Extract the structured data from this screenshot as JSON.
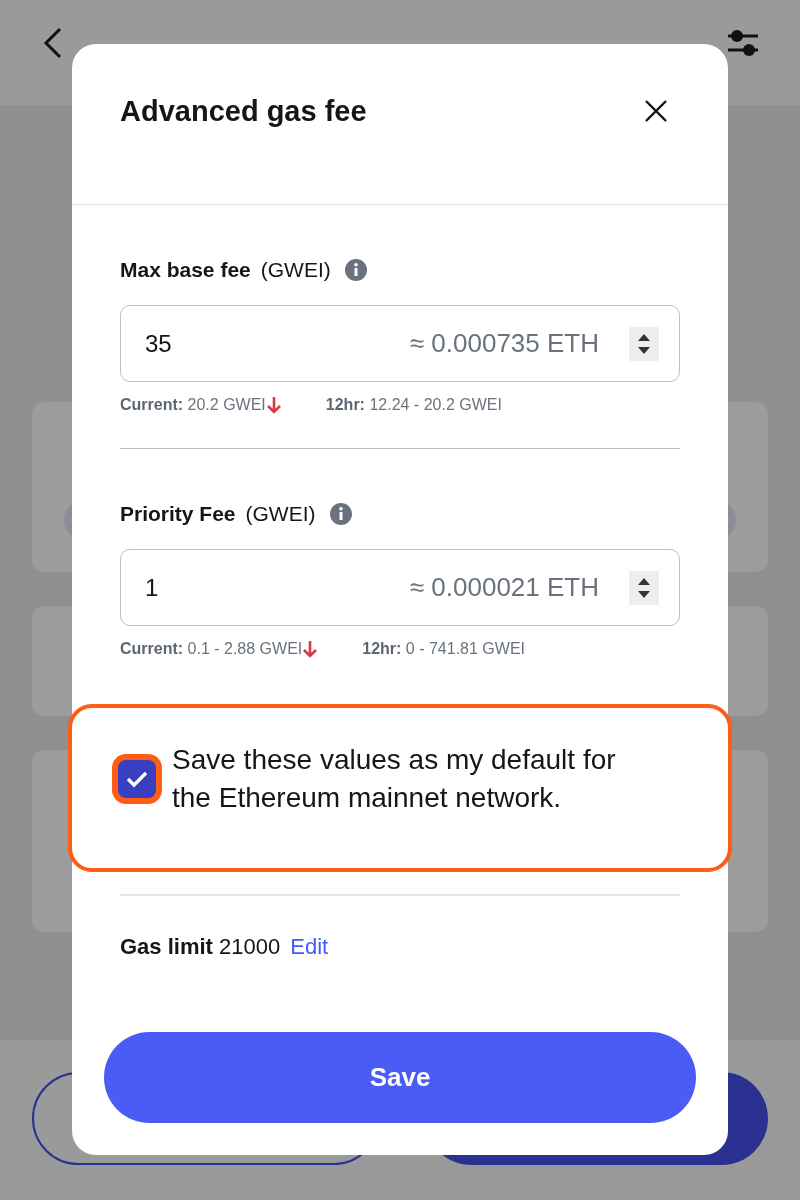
{
  "modal": {
    "title": "Advanced gas fee",
    "fields": [
      {
        "label": "Max base fee",
        "unit": "(GWEI)",
        "value": "35",
        "estimate": "≈ 0.000735 ETH",
        "current_label": "Current:",
        "current": "20.2 GWEI",
        "range_label": "12hr:",
        "range": "12.24 - 20.2 GWEI"
      },
      {
        "label": "Priority Fee",
        "unit": "(GWEI)",
        "value": "1",
        "estimate": "≈ 0.000021 ETH",
        "current_label": "Current:",
        "current": "0.1 - 2.88 GWEI",
        "range_label": "12hr:",
        "range": "0 - 741.81 GWEI"
      }
    ],
    "save_default": {
      "text": "Save these values as my default for the Ethereum mainnet network.",
      "checked": true,
      "highlighted": true
    },
    "gas_limit": {
      "label": "Gas limit",
      "value": "21000",
      "link": "Edit"
    },
    "button": "Save"
  }
}
